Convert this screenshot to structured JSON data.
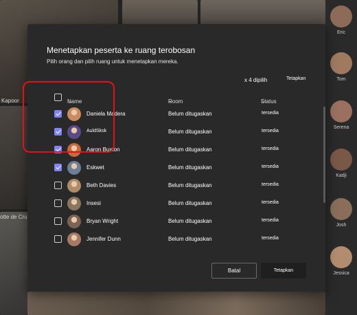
{
  "background": {
    "labels": {
      "kapoor": "Kapoor",
      "otte": "otte de Cru"
    },
    "participants": [
      "Eric",
      "Tom",
      "Serena",
      "Kadji",
      "Josh",
      "Jessica"
    ]
  },
  "dialog": {
    "title": "Menetapkan peserta ke ruang terobosan",
    "subtitle": "Pilih orang dan pilih ruang untuk menetapkan mereka.",
    "selected_count": "x 4 dipilih",
    "assign_link": "Tetapkan",
    "columns": {
      "name": "Name",
      "room": "Room",
      "status": "Status"
    },
    "rows": [
      {
        "name": "Daniela Madera",
        "room": "Belum ditugaskan",
        "status": "tersedia",
        "checked": true,
        "avatar_color": "#c98b5f"
      },
      {
        "name": "AuldSksk",
        "room": "Belum ditugaskan",
        "status": "tersedia",
        "checked": true,
        "avatar_color": "#5b4a8a"
      },
      {
        "name": "Aaron Buxton",
        "room": "Belum ditugaskan",
        "status": "tersedia",
        "checked": true,
        "avatar_color": "#c56a3f"
      },
      {
        "name": "Eskwet",
        "room": "Belum ditugaskan",
        "status": "tersedia",
        "checked": true,
        "avatar_color": "#6b7f96"
      },
      {
        "name": "Beth Davies",
        "room": "Belum ditugaskan",
        "status": "tersedia",
        "checked": false,
        "avatar_color": "#b08b6a"
      },
      {
        "name": "Insesi",
        "room": "Belum ditugaskan",
        "status": "tersedia",
        "checked": false,
        "avatar_color": "#8a7560"
      },
      {
        "name": "Bryan Wright",
        "room": "Belum ditugaskan",
        "status": "tersedia",
        "checked": false,
        "avatar_color": "#7a6352"
      },
      {
        "name": "Jennifer Dunn",
        "room": "Belum ditugaskan",
        "status": "tersedia",
        "checked": false,
        "avatar_color": "#a47a62"
      }
    ],
    "buttons": {
      "cancel": "Batal",
      "assign": "Tetapkan"
    }
  },
  "colors": {
    "accent": "#7f85f5",
    "highlight": "#e0121a",
    "dialog_bg": "#292929"
  }
}
